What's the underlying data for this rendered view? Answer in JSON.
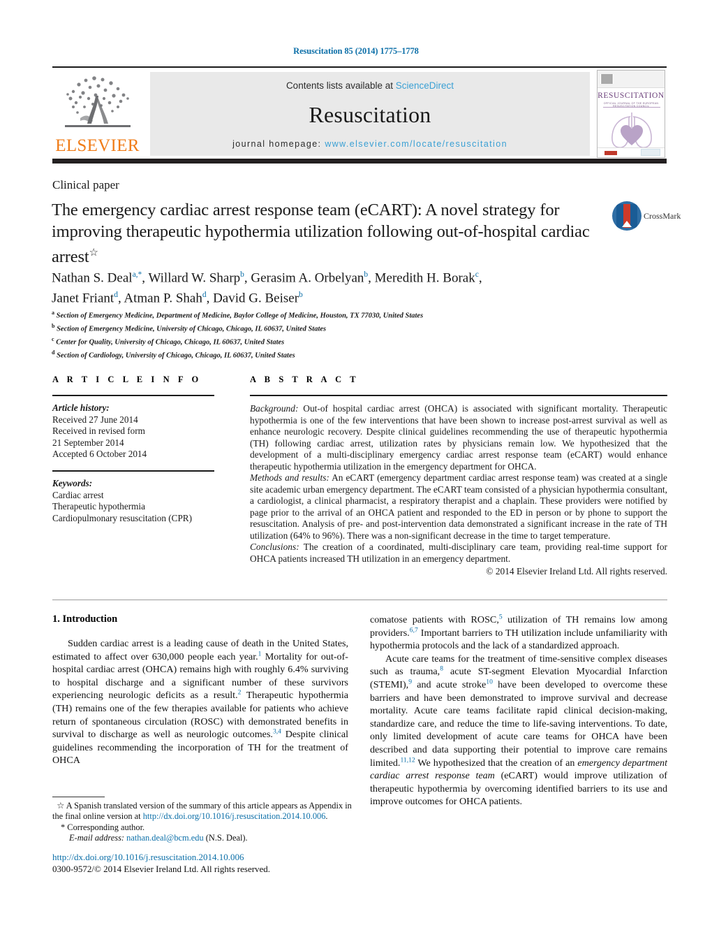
{
  "running_head": "Resuscitation 85 (2014) 1775–1778",
  "masthead": {
    "contents_prefix": "Contents lists available at ",
    "sciencedirect": "ScienceDirect",
    "journal_name": "Resuscitation",
    "homepage_prefix": "journal homepage: ",
    "homepage_url": "www.elsevier.com/locate/resuscitation",
    "publisher_logo_text": "ELSEVIER",
    "cover": {
      "title": "RESUSCITATION",
      "subtitle": "OFFICIAL JOURNAL OF THE EUROPEAN RESUSCITATION COUNCIL"
    },
    "link_color": "#3aa0d4"
  },
  "article": {
    "section_label": "Clinical paper",
    "title": "The emergency cardiac arrest response team (eCART): A novel strategy for improving therapeutic hypothermia utilization following out-of-hospital cardiac arrest",
    "title_footnote_marker": "☆",
    "crossmark_label": "CrossMark",
    "authors_line_1": "Nathan S. Deal a,*, Willard W. Sharp b, Gerasim A. Orbelyan b, Meredith H. Borak c,",
    "authors_line_2": "Janet Friant d, Atman P. Shah d, David G. Beiser b",
    "authors": [
      {
        "name": "Nathan S. Deal",
        "marks": "a,*"
      },
      {
        "name": "Willard W. Sharp",
        "marks": "b"
      },
      {
        "name": "Gerasim A. Orbelyan",
        "marks": "b"
      },
      {
        "name": "Meredith H. Borak",
        "marks": "c"
      },
      {
        "name": "Janet Friant",
        "marks": "d"
      },
      {
        "name": "Atman P. Shah",
        "marks": "d"
      },
      {
        "name": "David G. Beiser",
        "marks": "b"
      }
    ],
    "affiliations": [
      {
        "mark": "a",
        "text": "Section of Emergency Medicine, Department of Medicine, Baylor College of Medicine, Houston, TX 77030, United States"
      },
      {
        "mark": "b",
        "text": "Section of Emergency Medicine, University of Chicago, Chicago, IL 60637, United States"
      },
      {
        "mark": "c",
        "text": "Center for Quality, University of Chicago, Chicago, IL 60637, United States"
      },
      {
        "mark": "d",
        "text": "Section of Cardiology, University of Chicago, Chicago, IL 60637, United States"
      }
    ]
  },
  "article_info": {
    "heading": "A R T I C L E    I N F O",
    "history_label": "Article history:",
    "history": [
      "Received 27 June 2014",
      "Received in revised form",
      "21 September 2014",
      "Accepted 6 October 2014"
    ],
    "keywords_label": "Keywords:",
    "keywords": [
      "Cardiac arrest",
      "Therapeutic hypothermia",
      "Cardiopulmonary resuscitation (CPR)"
    ]
  },
  "abstract": {
    "heading": "A B S T R A C T",
    "background_label": "Background:",
    "background_text": " Out-of hospital cardiac arrest (OHCA) is associated with significant mortality. Therapeutic hypothermia is one of the few interventions that have been shown to increase post-arrest survival as well as enhance neurologic recovery. Despite clinical guidelines recommending the use of therapeutic hypothermia (TH) following cardiac arrest, utilization rates by physicians remain low. We hypothesized that the development of a multi-disciplinary emergency cardiac arrest response team (eCART) would enhance therapeutic hypothermia utilization in the emergency department for OHCA.",
    "methods_label": "Methods and results:",
    "methods_text": " An eCART (emergency department cardiac arrest response team) was created at a single site academic urban emergency department. The eCART team consisted of a physician hypothermia consultant, a cardiologist, a clinical pharmacist, a respiratory therapist and a chaplain. These providers were notified by page prior to the arrival of an OHCA patient and responded to the ED in person or by phone to support the resuscitation. Analysis of pre- and post-intervention data demonstrated a significant increase in the rate of TH utilization (64% to 96%). There was a non-significant decrease in the time to target temperature.",
    "conclusions_label": "Conclusions:",
    "conclusions_text": " The creation of a coordinated, multi-disciplinary care team, providing real-time support for OHCA patients increased TH utilization in an emergency department.",
    "copyright": "© 2014 Elsevier Ireland Ltd. All rights reserved."
  },
  "introduction": {
    "heading": "1.  Introduction",
    "left_para_1_a": "Sudden cardiac arrest is a leading cause of death in the United States, estimated to affect over 630,000 people each year.",
    "left_ref_1": "1",
    "left_para_1_b": " Mortality for out-of-hospital cardiac arrest (OHCA) remains high with roughly 6.4% surviving to hospital discharge and a significant number of these survivors experiencing neurologic deficits as a result.",
    "left_ref_2": "2",
    "left_para_1_c": " Therapeutic hypothermia (TH) remains one of the few therapies available for patients who achieve return of spontaneous circulation (ROSC) with demonstrated benefits in survival to discharge as well as neurologic outcomes.",
    "left_ref_34": "3,4",
    "left_para_1_d": " Despite clinical guidelines recommending the incorporation of TH for the treatment of OHCA",
    "right_para_1_a": "comatose patients with ROSC,",
    "right_ref_5": "5",
    "right_para_1_b": " utilization of TH remains low among providers.",
    "right_ref_67": "6,7",
    "right_para_1_c": " Important barriers to TH utilization include unfamiliarity with hypothermia protocols and the lack of a standardized approach.",
    "right_para_2_a": "Acute care teams for the treatment of time-sensitive complex diseases such as trauma,",
    "right_ref_8": "8",
    "right_para_2_b": " acute ST-segment Elevation Myocardial Infarction (STEMI),",
    "right_ref_9": "9",
    "right_para_2_c": " and acute stroke",
    "right_ref_10": "10",
    "right_para_2_d": " have been developed to overcome these barriers and have been demonstrated to improve survival and decrease mortality. Acute care teams facilitate rapid clinical decision-making, standardize care, and reduce the time to life-saving interventions. To date, only limited development of acute care teams for OHCA have been described and data supporting their potential to improve care remains limited.",
    "right_ref_1112": "11,12",
    "right_para_2_e": " We hypothesized that the creation of an ",
    "right_para_2_em": "emergency department cardiac arrest response team",
    "right_para_2_f": " (eCART) would improve utilization of therapeutic hypothermia by overcoming identified barriers to its use and improve outcomes for OHCA patients."
  },
  "footnotes": {
    "star_marker": "☆",
    "star_text_a": " A Spanish translated version of the summary of this article appears as Appendix in the final online version at ",
    "star_link": "http://dx.doi.org/10.1016/j.resuscitation.2014.10.006",
    "star_text_b": ".",
    "corresponding_marker": "*",
    "corresponding_text": " Corresponding author.",
    "email_label": "E-mail address:",
    "email": "nathan.deal@bcm.edu",
    "email_suffix": " (N.S. Deal).",
    "doi_url": "http://dx.doi.org/10.1016/j.resuscitation.2014.10.006",
    "issn_line": "0300-9572/© 2014 Elsevier Ireland Ltd. All rights reserved."
  },
  "colors": {
    "link": "#0c6fa8",
    "elsevier_orange": "#f07c18",
    "sciencedirect_blue": "#3aa0d4",
    "cover_purple": "#6b3f7a"
  }
}
